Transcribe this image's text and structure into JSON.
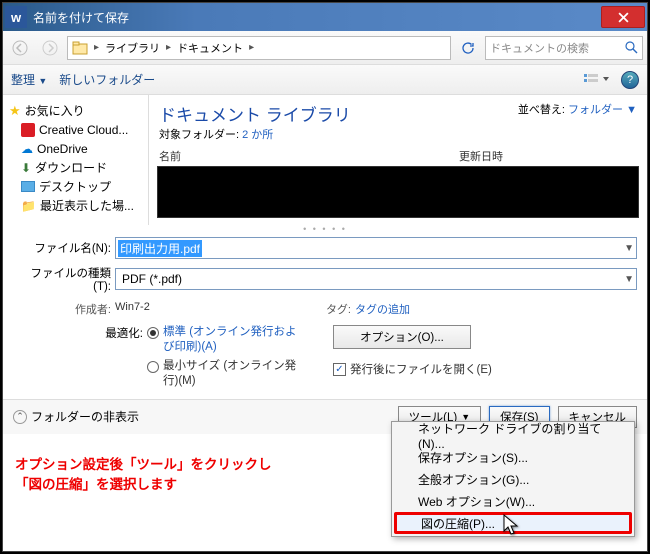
{
  "titlebar": {
    "app_glyph": "w",
    "title": "名前を付けて保存"
  },
  "nav": {
    "breadcrumb": [
      "ライブラリ",
      "ドキュメント"
    ],
    "search_placeholder": "ドキュメントの検索"
  },
  "toolbar": {
    "organize": "整理",
    "new_folder": "新しいフォルダー"
  },
  "sidebar": {
    "favorites": "お気に入り",
    "items": [
      "Creative Cloud...",
      "OneDrive",
      "ダウンロード",
      "デスクトップ",
      "最近表示した場..."
    ]
  },
  "main": {
    "lib_title": "ドキュメント ライブラリ",
    "lib_sub_label": "対象フォルダー: ",
    "lib_sub_link": "2 か所",
    "sort_label": "並べ替え:",
    "sort_value": "フォルダー",
    "col_name": "名前",
    "col_date": "更新日時"
  },
  "form": {
    "filename_label": "ファイル名(N):",
    "filename_value": "印刷出力用.pdf",
    "filetype_label": "ファイルの種類(T):",
    "filetype_value": "PDF (*.pdf)",
    "author_label": "作成者:",
    "author_value": "Win7-2",
    "tags_label": "タグ:",
    "tags_value": "タグの追加",
    "optimize_label": "最適化:",
    "radio1": "標準 (オンライン発行および印刷)(A)",
    "radio2": "最小サイズ (オンライン発行)(M)",
    "options_btn": "オプション(O)...",
    "open_after": "発行後にファイルを開く(E)"
  },
  "footer": {
    "hide_folders": "フォルダーの非表示",
    "tools": "ツール(L)",
    "save": "保存(S)",
    "cancel": "キャンセル"
  },
  "menu": {
    "items": [
      "ネットワーク ドライブの割り当て(N)...",
      "保存オプション(S)...",
      "全般オプション(G)...",
      "Web オプション(W)...",
      "図の圧縮(P)..."
    ],
    "highlight_index": 4
  },
  "caption": {
    "line1": "オプション設定後「ツール」をクリックし",
    "line2": "「図の圧縮」を選択します"
  }
}
